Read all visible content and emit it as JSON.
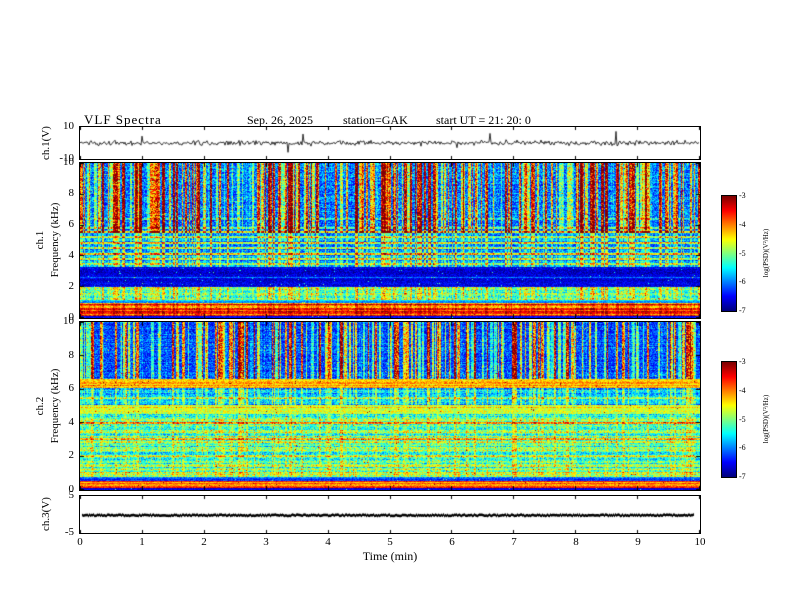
{
  "header": {
    "title": "VLF  Spectra",
    "date": "Sep. 26, 2025",
    "station": "station=GAK",
    "start_ut": "start UT  =   21: 20: 0"
  },
  "axis": {
    "time_label": "Time  (min)"
  },
  "panel_labels": {
    "ch1": "ch.1(V)",
    "spec1_ch": "ch.1",
    "spec2_ch": "ch.2",
    "freq": "Frequency  (kHz)",
    "ch3": "ch.3(V)"
  },
  "y_ticks": {
    "wave_top": "10",
    "wave_bottom": "-10",
    "spec": [
      "10",
      "8",
      "6",
      "4",
      "2",
      "0"
    ],
    "ch3_top": "5",
    "ch3_bottom": "-5"
  },
  "x_ticks": [
    "0",
    "1",
    "2",
    "3",
    "4",
    "5",
    "6",
    "7",
    "8",
    "9",
    "10"
  ],
  "colorbar": {
    "label": "log(PSD)(V²/Hz)",
    "ticks": [
      "-3",
      "-4",
      "-5",
      "-6",
      "-7"
    ],
    "min": -7,
    "max": -3
  },
  "chart_data": {
    "type": "heatmap",
    "subtype": "vlf-multipanel-spectrogram",
    "title": "VLF Spectra",
    "date": "Sep. 26, 2025",
    "station": "GAK",
    "start_ut": "21:20:0",
    "x": {
      "label": "Time (min)",
      "min": 0,
      "max": 10,
      "ticks": [
        0,
        1,
        2,
        3,
        4,
        5,
        6,
        7,
        8,
        9,
        10
      ]
    },
    "colormap": "jet",
    "z": {
      "label": "log(PSD)(V²/Hz)",
      "min": -7,
      "max": -3
    },
    "panels": [
      {
        "id": "ch1-waveform",
        "kind": "line",
        "ylabel": "ch.1(V)",
        "ymin": -10,
        "ymax": 10,
        "content": "broadband noise waveform fluctuating around 0 V for 10 minutes"
      },
      {
        "id": "ch1-spectrogram",
        "kind": "spectrogram",
        "channel": "ch.1",
        "ylabel": "Frequency (kHz)",
        "ymin": 0,
        "ymax": 10,
        "content": "dense vertical sferic streaks above ~5.5 kHz, dark band 2-3.2 kHz, bright power-line band below 1 kHz, horizontal tweek lines 3.5-6 kHz"
      },
      {
        "id": "ch2-spectrogram",
        "kind": "spectrogram",
        "channel": "ch.2",
        "ylabel": "Frequency (kHz)",
        "ymin": 0,
        "ymax": 10,
        "content": "bright continuous band near 6.3 kHz, green band near 4.8 kHz, speckled cyan 1-4.5 kHz, bright band below 0.5 kHz, sferic streaks above 6.6 kHz"
      },
      {
        "id": "ch3-trace",
        "kind": "line",
        "ylabel": "ch.3(V)",
        "ymin": -5,
        "ymax": 5,
        "content": "flat constant trace near 0 V"
      }
    ],
    "render": {
      "wave": {
        "seed": 7
      },
      "ch3": {
        "seed": 11
      },
      "spec1": {
        "seed": 101,
        "streakProb": 0.32,
        "bands": [
          {
            "f0": 0.0,
            "f1": 0.12,
            "base": -6.6,
            "noise": 0.2,
            "rowAmp": 0.1
          },
          {
            "f0": 0.12,
            "f1": 0.95,
            "base": -3.9,
            "noise": 0.35,
            "rowAmp": 0.5
          },
          {
            "f0": 0.95,
            "f1": 1.15,
            "base": -5.8,
            "noise": 0.3,
            "rowAmp": 0.2
          },
          {
            "f0": 1.15,
            "f1": 1.95,
            "base": -5.25,
            "noise": 0.55,
            "rowAmp": 0.3
          },
          {
            "f0": 1.95,
            "f1": 3.25,
            "base": -6.65,
            "noise": 0.3,
            "rowAmp": 0.15
          },
          {
            "f0": 3.25,
            "f1": 6.0,
            "base": -6.05,
            "noise": 0.45,
            "rowAmp": 0.25
          },
          {
            "f0": 6.0,
            "f1": 10.01,
            "base": -6.0,
            "noise": 0.55,
            "rowAmp": 0.2
          }
        ],
        "lines": [
          {
            "f": 3.45,
            "amp": 1.2
          },
          {
            "f": 3.8,
            "amp": 1.0
          },
          {
            "f": 4.15,
            "amp": 1.3
          },
          {
            "f": 4.5,
            "amp": 1.0
          },
          {
            "f": 4.85,
            "amp": 1.2
          },
          {
            "f": 5.2,
            "amp": 1.0
          },
          {
            "f": 5.55,
            "amp": 1.4
          },
          {
            "f": 5.8,
            "amp": 1.0
          },
          {
            "f": 6.4,
            "amp": 0.7
          },
          {
            "f": 2.6,
            "amp": 0.5
          }
        ],
        "streakZones": [
          {
            "f0": 5.5,
            "f1": 10.01,
            "gain": 2.3
          },
          {
            "f0": 3.25,
            "f1": 5.5,
            "gain": 0.9
          },
          {
            "f0": 1.15,
            "f1": 1.95,
            "gain": 0.7
          },
          {
            "f0": 0.12,
            "f1": 0.95,
            "gain": 0.3
          }
        ]
      },
      "spec2": {
        "seed": 202,
        "streakProb": 0.3,
        "bands": [
          {
            "f0": 0.0,
            "f1": 0.1,
            "base": -6.6,
            "noise": 0.2,
            "rowAmp": 0.1
          },
          {
            "f0": 0.1,
            "f1": 0.5,
            "base": -3.9,
            "noise": 0.3,
            "rowAmp": 0.4
          },
          {
            "f0": 0.5,
            "f1": 0.75,
            "base": -6.2,
            "noise": 0.3,
            "rowAmp": 0.2
          },
          {
            "f0": 0.75,
            "f1": 4.55,
            "base": -5.15,
            "noise": 0.55,
            "rowAmp": 0.55
          },
          {
            "f0": 4.55,
            "f1": 5.05,
            "base": -4.55,
            "noise": 0.4,
            "rowAmp": 0.3
          },
          {
            "f0": 5.05,
            "f1": 6.1,
            "base": -5.8,
            "noise": 0.5,
            "rowAmp": 0.35
          },
          {
            "f0": 6.1,
            "f1": 6.6,
            "base": -4.15,
            "noise": 0.35,
            "rowAmp": 0.3
          },
          {
            "f0": 6.6,
            "f1": 10.01,
            "base": -6.2,
            "noise": 0.45,
            "rowAmp": 0.2
          }
        ],
        "lines": [
          {
            "f": 1.0,
            "amp": 0.6
          },
          {
            "f": 2.0,
            "amp": 0.5
          },
          {
            "f": 3.0,
            "amp": 0.5
          },
          {
            "f": 4.0,
            "amp": 0.6
          },
          {
            "f": 5.5,
            "amp": 0.6
          }
        ],
        "streakZones": [
          {
            "f0": 6.6,
            "f1": 10.01,
            "gain": 2.2
          },
          {
            "f0": 5.05,
            "f1": 6.1,
            "gain": 0.8
          },
          {
            "f0": 0.75,
            "f1": 4.55,
            "gain": 0.45
          }
        ]
      }
    }
  }
}
